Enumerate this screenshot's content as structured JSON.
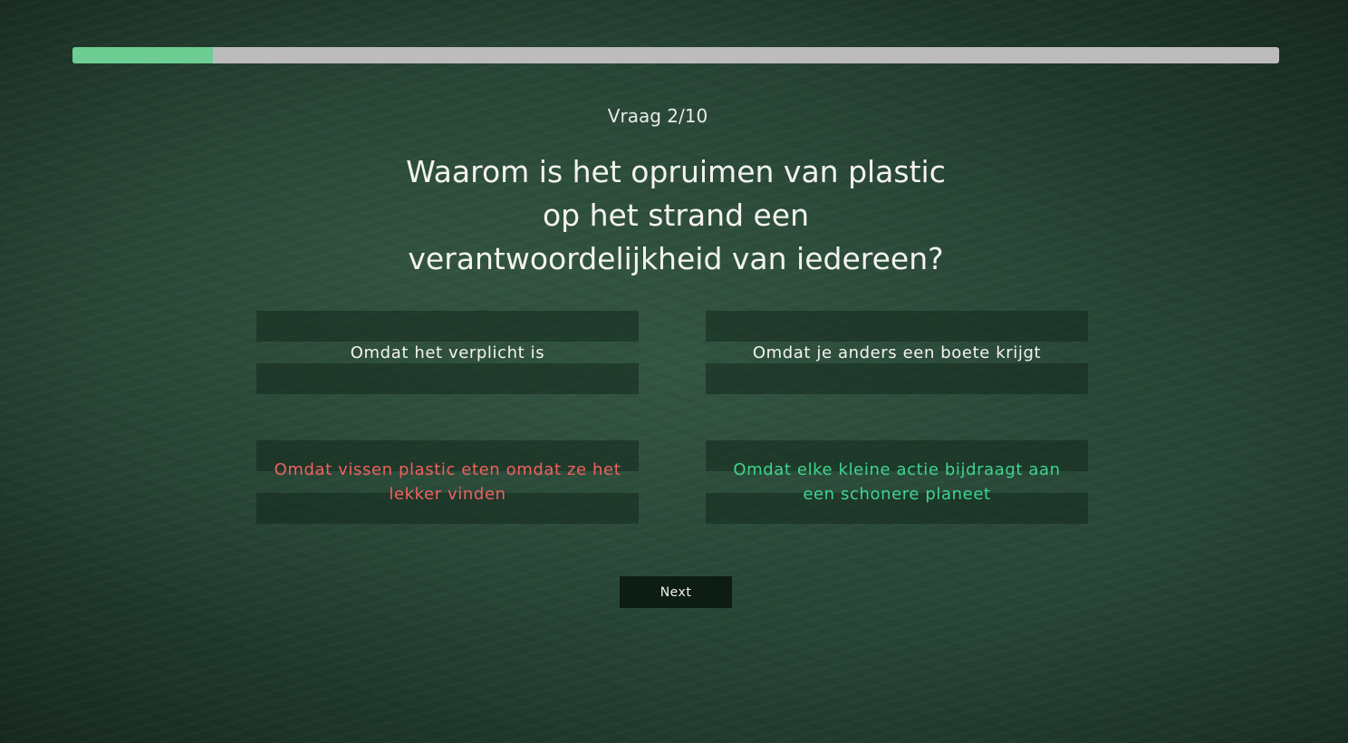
{
  "progress": {
    "fraction": 0.116,
    "fill_color": "#6dcd93",
    "track_color": "#bdbcbc"
  },
  "quiz": {
    "counter": "Vraag 2/10",
    "question": "Waarom is het opruimen van plastic op het strand een verantwoordelijkheid van iedereen?",
    "answers": [
      {
        "label": "Omdat het verplicht is",
        "state": "neutral"
      },
      {
        "label": "Omdat je anders een boete krijgt",
        "state": "neutral"
      },
      {
        "label": "Omdat vissen plastic eten omdat ze het lekker vinden",
        "state": "wrong"
      },
      {
        "label": "Omdat elke kleine actie bijdraagt aan een schonere planeet",
        "state": "correct"
      }
    ],
    "state_colors": {
      "neutral": "#f4f4f0",
      "wrong": "#f0615e",
      "correct": "#3ed68e"
    },
    "next_label": "Next"
  }
}
